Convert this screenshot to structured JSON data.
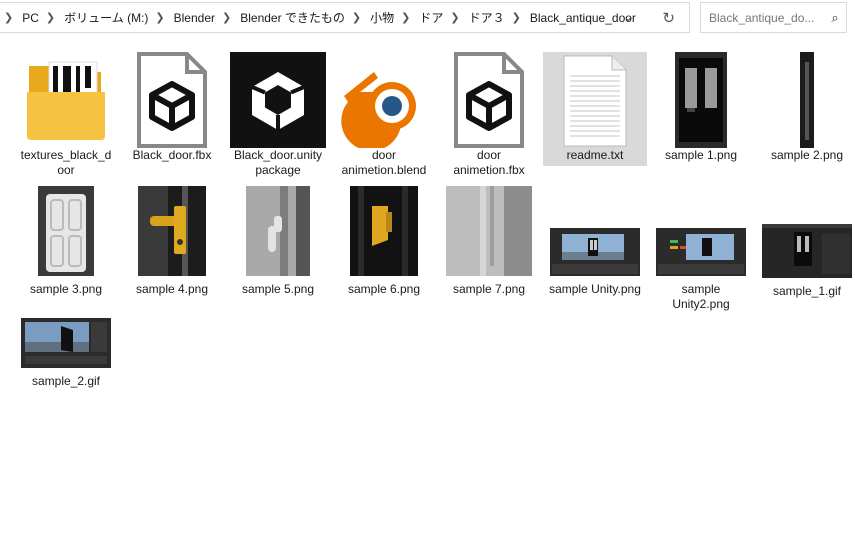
{
  "breadcrumb": [
    "PC",
    "ボリューム (M:)",
    "Blender",
    "Blender できたもの",
    "小物",
    "ドア",
    "ドア３",
    "Black_antique_door"
  ],
  "search": {
    "placeholder": "Black_antique_do..."
  },
  "icons": {
    "dropdown": "chevron-down-icon",
    "refresh": "refresh-icon",
    "search": "search-icon"
  },
  "files": [
    {
      "line1": "textures_black_d",
      "line2": "oor",
      "type": "folder"
    },
    {
      "line1": "Black_door.fbx",
      "line2": "",
      "type": "fbx"
    },
    {
      "line1": "Black_door.unity",
      "line2": "package",
      "type": "unitypackage"
    },
    {
      "line1": "door",
      "line2": "animetion.blend",
      "type": "blend"
    },
    {
      "line1": "door",
      "line2": "animetion.fbx",
      "type": "fbx"
    },
    {
      "line1": "readme.txt",
      "line2": "",
      "type": "txt",
      "selected": true
    },
    {
      "line1": "sample 1.png",
      "line2": "",
      "type": "png"
    },
    {
      "line1": "sample 2.png",
      "line2": "",
      "type": "png"
    },
    {
      "line1": "sample 3.png",
      "line2": "",
      "type": "png"
    },
    {
      "line1": "sample 4.png",
      "line2": "",
      "type": "png"
    },
    {
      "line1": "sample 5.png",
      "line2": "",
      "type": "png"
    },
    {
      "line1": "sample 6.png",
      "line2": "",
      "type": "png"
    },
    {
      "line1": "sample 7.png",
      "line2": "",
      "type": "png"
    },
    {
      "line1": "sample Unity.png",
      "line2": "",
      "type": "png"
    },
    {
      "line1": "sample",
      "line2": "Unity2.png",
      "type": "png"
    },
    {
      "line1": "sample_1.gif",
      "line2": "",
      "type": "gif"
    },
    {
      "line1": "sample_2.gif",
      "line2": "",
      "type": "gif"
    }
  ],
  "colors": {
    "selection": "#d9d9d9",
    "folder": "#f5c242",
    "blender_orange": "#ea7600",
    "blender_blue": "#265787"
  }
}
